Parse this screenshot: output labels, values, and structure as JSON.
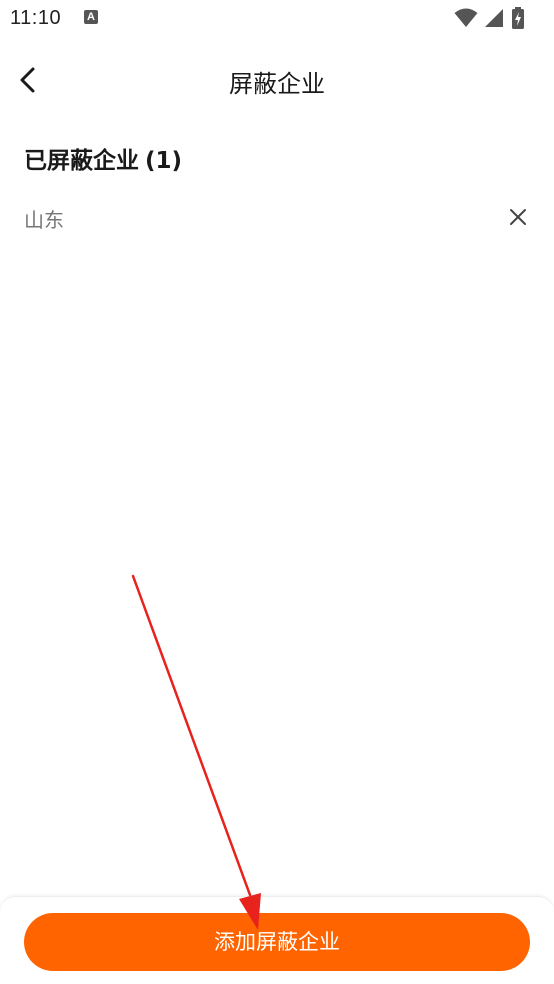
{
  "status_bar": {
    "time": "11:10",
    "notification_icon_letter": "A",
    "icons": [
      "notification-a-icon",
      "wifi-icon",
      "cell-signal-icon",
      "battery-charging-icon"
    ]
  },
  "header": {
    "back_icon": "chevron-left-icon",
    "title": "屏蔽企业"
  },
  "blocked_section": {
    "title": "已屏蔽企业",
    "count": "(1)",
    "items": [
      {
        "label": "山东",
        "remove_icon": "close-icon"
      }
    ]
  },
  "footer": {
    "add_button_label": "添加屏蔽企业"
  },
  "colors": {
    "accent": "#ff6400",
    "annotation_arrow": "#e8221c",
    "text_primary": "#1a1a1a",
    "text_secondary": "#777777"
  }
}
